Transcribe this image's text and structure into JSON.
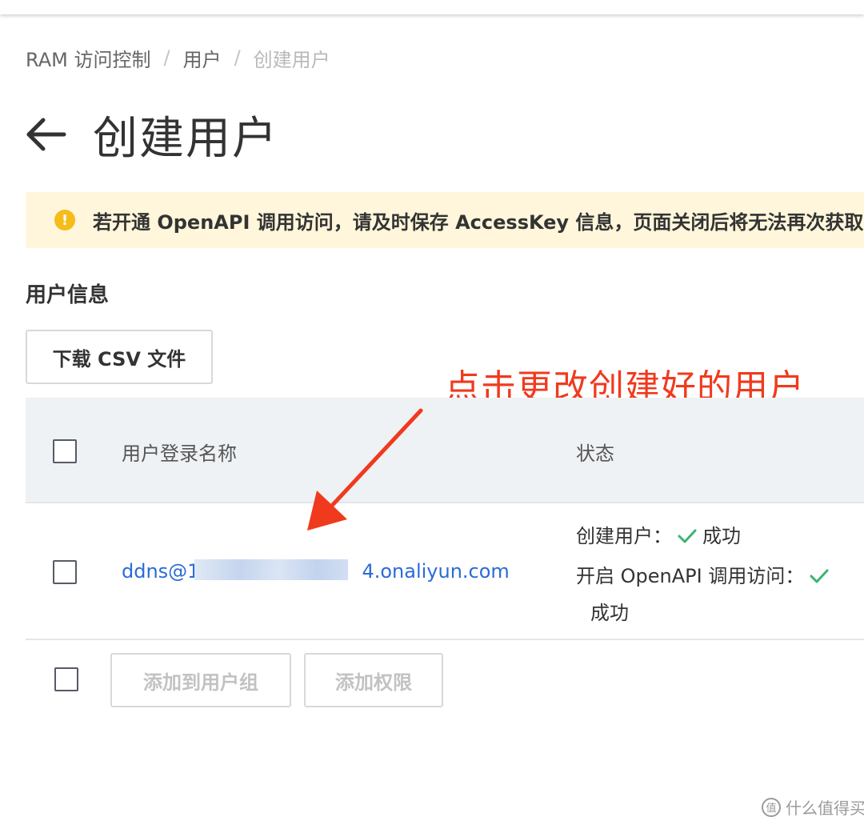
{
  "breadcrumb": {
    "items": [
      "RAM 访问控制",
      "用户",
      "创建用户"
    ],
    "separator": "/"
  },
  "page": {
    "title": "创建用户",
    "back_icon": "arrow-left-icon"
  },
  "alert": {
    "icon": "warning-circle-icon",
    "text": "若开通 OpenAPI 调用访问，请及时保存 AccessKey 信息，页面关闭后将无法再次获取"
  },
  "section": {
    "title": "用户信息"
  },
  "toolbar": {
    "download_csv_label": "下载 CSV 文件"
  },
  "annotation": {
    "text": "点击更改创建好的用户",
    "color": "#f03a1e"
  },
  "table": {
    "columns": [
      "用户登录名称",
      "状态"
    ],
    "rows": [
      {
        "login_name_prefix": "ddns@1",
        "login_name_suffix": "4.onaliyun.com",
        "status": {
          "create_user_label": "创建用户：",
          "create_user_result": "成功",
          "openapi_label": "开启 OpenAPI 调用访问：",
          "openapi_result": "成功"
        }
      }
    ]
  },
  "footer_actions": {
    "add_to_group_label": "添加到用户组",
    "add_permission_label": "添加权限"
  },
  "watermark": {
    "logo": "值",
    "text": "什么值得买"
  },
  "colors": {
    "link": "#2a6bd6",
    "success": "#3cb371",
    "warning": "#f5bc1a",
    "alert_bg": "#fff6db",
    "header_bg": "#eff2f5"
  }
}
